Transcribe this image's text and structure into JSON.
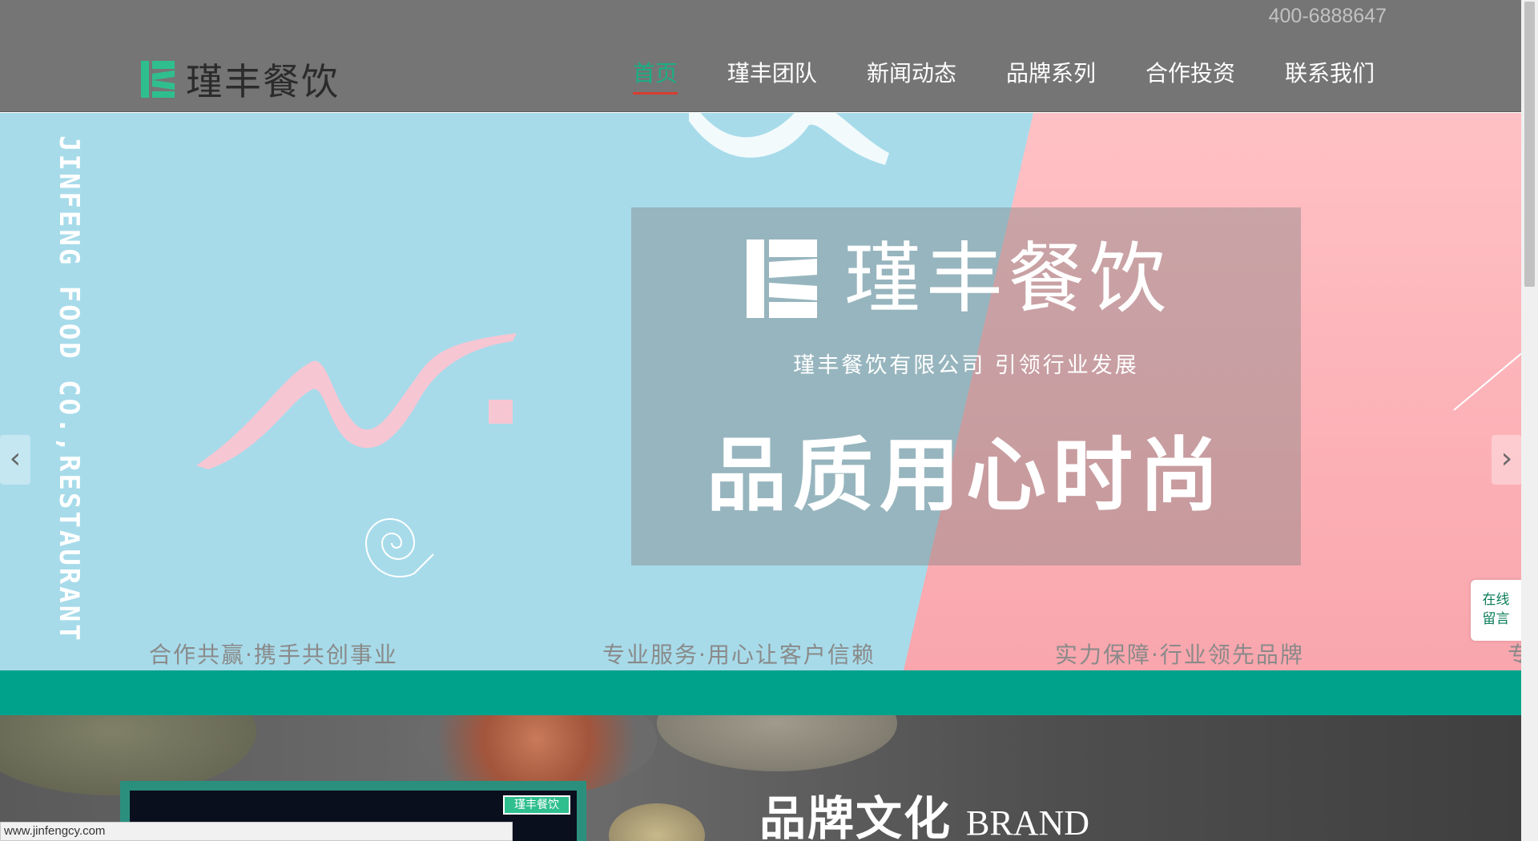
{
  "header": {
    "phone": "400-6888647",
    "logo_text": "瑾丰餐饮",
    "nav": [
      {
        "label": "首页",
        "active": true
      },
      {
        "label": "瑾丰团队",
        "active": false
      },
      {
        "label": "新闻动态",
        "active": false
      },
      {
        "label": "品牌系列",
        "active": false
      },
      {
        "label": "合作投资",
        "active": false
      },
      {
        "label": "联系我们",
        "active": false
      }
    ]
  },
  "banner": {
    "vertical_text": "JINFENG FOOD CO.,RESTAURANT",
    "box_logo_text": "瑾丰餐饮",
    "box_subtitle": "瑾丰餐饮有限公司   引领行业发展",
    "box_headline": "品质用心时尚",
    "slogans": [
      "合作共赢·携手共创事业",
      "专业服务·用心让客户信赖",
      "实力保障·行业领先品牌",
      "专"
    ],
    "prev_arrow": "‹",
    "next_arrow": "›"
  },
  "widget": {
    "line1": "在线",
    "line2": "留言"
  },
  "brand": {
    "title_cn": "品牌文化",
    "title_en": "BRAND",
    "video_badge": "瑾丰餐饮"
  },
  "statusbar": {
    "url": "www.jinfengcy.com"
  },
  "colors": {
    "accent_green": "#00a28c",
    "active_nav": "#17b084",
    "active_underline": "#d93c2e",
    "header_bg": "#757575",
    "banner_blue": "#a7dbea",
    "banner_pink": "#ffc1c5"
  }
}
